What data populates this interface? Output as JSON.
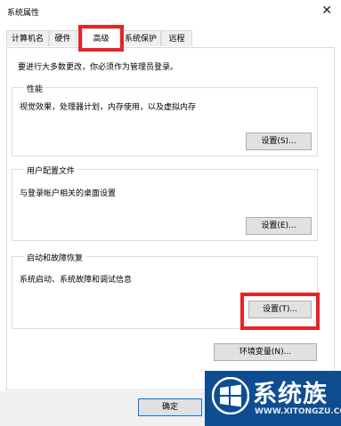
{
  "window": {
    "title": "系统属性",
    "close_glyph": "✕"
  },
  "tabs": [
    "计算机名",
    "硬件",
    "高级",
    "系统保护",
    "远程"
  ],
  "admin_note": "要进行大多数更改，你必须作为管理员登录。",
  "performance": {
    "title": "性能",
    "desc": "视觉效果，处理器计划，内存使用，以及虚拟内存",
    "button": "设置(S)..."
  },
  "user_profiles": {
    "title": "用户配置文件",
    "desc": "与登录帐户相关的桌面设置",
    "button": "设置(E)..."
  },
  "startup_recovery": {
    "title": "启动和故障恢复",
    "desc": "系统启动、系统故障和调试信息",
    "button": "设置(T)..."
  },
  "env_button": "环境变量(N)...",
  "ok_button": "确定",
  "watermark": {
    "name": "系统族",
    "url": "WWW.XITONGZU.COM"
  },
  "colors": {
    "highlight": "#e5252b",
    "watermark_bg": "#0e4d8f",
    "focus_border": "#0078d7"
  }
}
